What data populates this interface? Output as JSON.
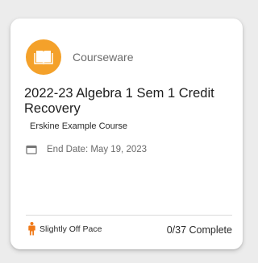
{
  "card": {
    "type_label": "Courseware",
    "type_icon": "book-icon",
    "accent_color": "#f4a12a",
    "title": "2022-23 Algebra 1 Sem 1 Credit Recovery",
    "subtitle": "Erskine Example Course",
    "end_date_label": "End Date: May 19, 2023",
    "pace_label": "Slightly Off Pace",
    "pace_icon": "person-icon",
    "pace_color": "#f07a1a",
    "progress_label": "0/37 Complete"
  }
}
